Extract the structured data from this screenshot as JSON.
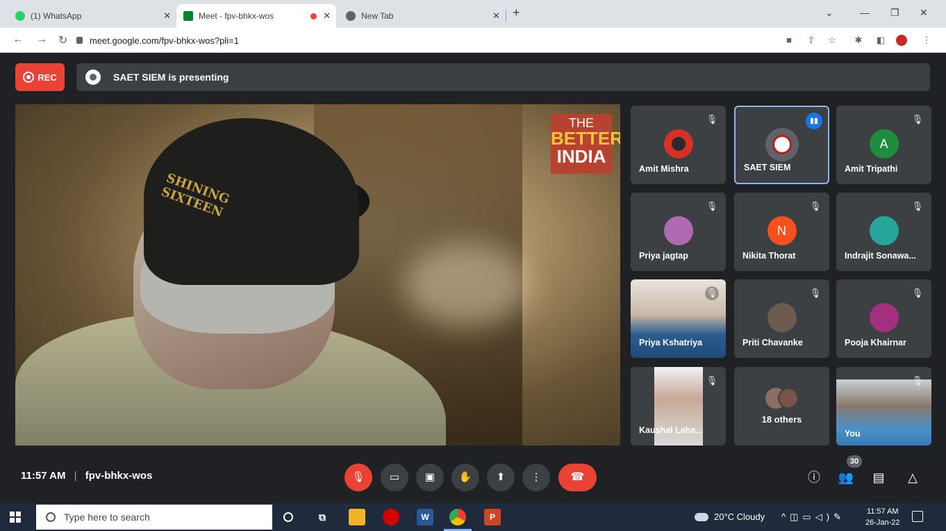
{
  "browser": {
    "tabs": [
      {
        "title": "(1) WhatsApp",
        "favicon": "whatsapp-icon",
        "color": "#25d366"
      },
      {
        "title": "Meet - fpv-bhkx-wos",
        "favicon": "meet-icon",
        "color": "#00832d",
        "recording": true
      },
      {
        "title": "New Tab",
        "favicon": "chrome-icon",
        "color": "#5f6368"
      }
    ],
    "url": "meet.google.com/fpv-bhkx-wos?pli=1"
  },
  "meet": {
    "rec_label": "REC",
    "presenting_text": "SAET SIEM is presenting",
    "video_watermark": {
      "line1": "THE",
      "line2": "BETTER",
      "line3": "INDIA"
    },
    "cap_text": "SHINING SIXTEEN",
    "participants": [
      {
        "name": "Amit Mishra",
        "avatar": "photo",
        "color": "#d93025",
        "muted": true
      },
      {
        "name": "SAET SIEM",
        "avatar": "logo",
        "color": "#ffffff",
        "speaking": true
      },
      {
        "name": "Amit Tripathi",
        "avatar": "A",
        "color": "#1e8e3e",
        "muted": true
      },
      {
        "name": "Priya jagtap",
        "avatar": "photo",
        "color": "#b06ab3",
        "muted": true
      },
      {
        "name": "Nikita Thorat",
        "avatar": "N",
        "color": "#f4511e",
        "muted": true
      },
      {
        "name": "Indrajit Sonawa...",
        "avatar": "photo",
        "color": "#26a69a",
        "muted": true
      },
      {
        "name": "Priya Kshatriya",
        "avatar": "video",
        "color": "#2c5d8f",
        "muted": true
      },
      {
        "name": "Priti Chavanke",
        "avatar": "photo",
        "color": "#6d5b4f",
        "muted": true
      },
      {
        "name": "Pooja Khairnar",
        "avatar": "photo",
        "color": "#a3307f",
        "muted": true
      },
      {
        "name": "Kaushal Laha...",
        "avatar": "video",
        "color": "#cfcfcf",
        "muted": true
      },
      {
        "name": "18 others",
        "avatar": "group",
        "color": "#8d6e63"
      },
      {
        "name": "You",
        "avatar": "video",
        "color": "#4a90c9",
        "muted": true
      }
    ],
    "time": "11:57 AM",
    "meeting_code": "fpv-bhkx-wos",
    "separator": "|",
    "participant_count": "30"
  },
  "taskbar": {
    "search_placeholder": "Type here to search",
    "weather": "20°C  Cloudy",
    "time": "11:57 AM",
    "date": "26-Jan-22"
  }
}
